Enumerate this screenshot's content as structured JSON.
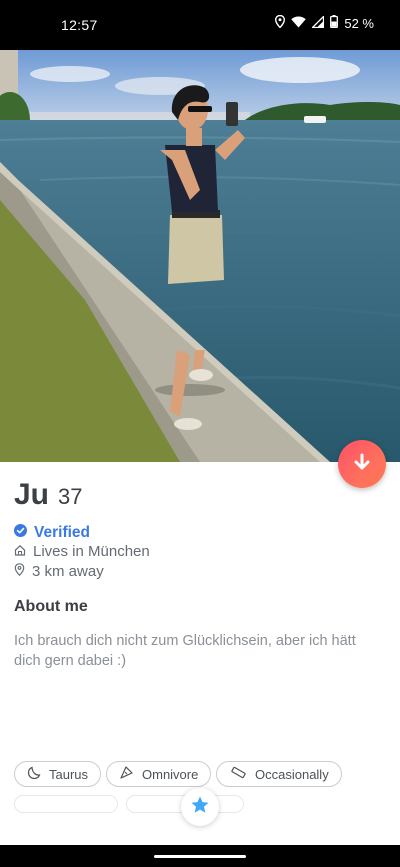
{
  "status_bar": {
    "time": "12:57",
    "battery": "52 %"
  },
  "profile": {
    "name": "Ju",
    "age": "37",
    "verified_label": "Verified",
    "lives_in": "Lives in München",
    "distance": "3 km away"
  },
  "about": {
    "title": "About me",
    "bio": "Ich brauch dich nicht zum Glücklichsein, aber ich hätt dich gern dabei :)"
  },
  "chips": [
    {
      "label": "Taurus",
      "icon": "moon-icon"
    },
    {
      "label": "Omnivore",
      "icon": "utensils-icon"
    },
    {
      "label": "Occasionally",
      "icon": "cigarette-icon"
    }
  ],
  "colors": {
    "accent": "#fd5068",
    "verified": "#3a79e0",
    "super_like": "#3fa9f5"
  }
}
